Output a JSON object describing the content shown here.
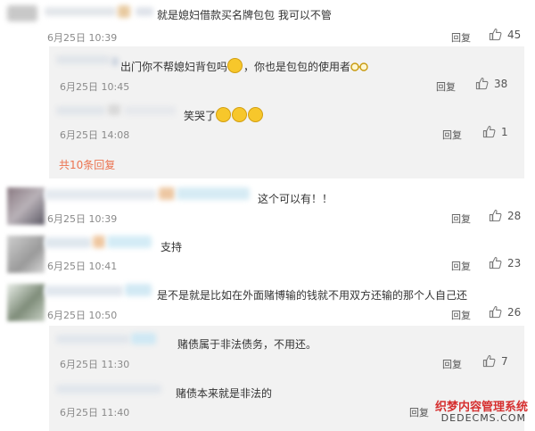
{
  "comments": [
    {
      "text": "就是媳妇借款买名牌包包 我可以不管",
      "time": "6月25日 10:39",
      "reply_label": "回复",
      "likes": "45",
      "replies": [
        {
          "text_a": "出门你不帮媳妇背包吗",
          "text_b": "，你也是包包的使用者",
          "time": "6月25日 10:45",
          "reply_label": "回复",
          "likes": "38"
        },
        {
          "text_a": "笑哭了",
          "time": "6月25日 14:08",
          "reply_label": "回复",
          "likes": "1"
        }
      ],
      "more_replies": "共10条回复"
    },
    {
      "text": "这个可以有！！",
      "time": "6月25日 10:39",
      "reply_label": "回复",
      "likes": "28"
    },
    {
      "text": "支持",
      "time": "6月25日 10:41",
      "reply_label": "回复",
      "likes": "23"
    },
    {
      "text": "是不是就是比如在外面赌博输的钱就不用双方还输的那个人自己还",
      "time": "6月25日 10:50",
      "reply_label": "回复",
      "likes": "26",
      "replies": [
        {
          "text": "赌债属于非法债务，不用还。",
          "time": "6月25日 11:30",
          "reply_label": "回复",
          "likes": "7"
        },
        {
          "text": "赌债本来就是非法的",
          "time": "6月25日 11:40",
          "reply_label": "回复"
        }
      ]
    }
  ],
  "watermark": {
    "line1": "织梦内容管理系统",
    "line2": "DEDECMS.COM"
  },
  "icons": {
    "like": "thumbs-up-icon",
    "laugh": "laughing-emoji-icon",
    "glasses": "glasses-emoji-icon",
    "smirk": "smirk-emoji-icon"
  },
  "colors": {
    "accent": "#eb7350",
    "reply_bg": "#f2f2f2",
    "meta": "#8a8a8a"
  }
}
